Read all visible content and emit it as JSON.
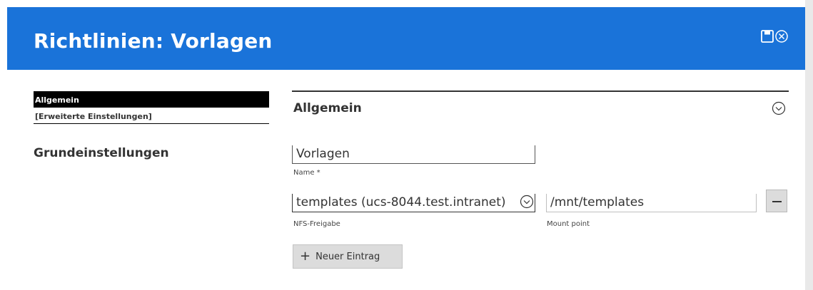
{
  "header": {
    "title": "Richtlinien: Vorlagen",
    "save_icon": "floppy-disk-icon",
    "close_icon": "circle-close-icon"
  },
  "nav": {
    "items": [
      {
        "label": "Allgemein",
        "active": true
      },
      {
        "label": "[Erweiterte Einstellungen]",
        "active": false
      }
    ],
    "section": "Grundeinstellungen"
  },
  "section": {
    "title": "Allgemein",
    "collapse_icon": "chevron-down-circle-icon"
  },
  "fields": {
    "name_value": "Vorlagen",
    "name_label": "Name *",
    "nfs_value": "templates (ucs-8044.test.intranet)",
    "nfs_label": "NFS-Freigabe",
    "mount_value": "/mnt/templates",
    "mount_label": "Mount point"
  },
  "buttons": {
    "add_label": "Neuer Eintrag"
  },
  "colors": {
    "header_bg": "#1a73d9",
    "active_nav_bg": "#000000"
  }
}
